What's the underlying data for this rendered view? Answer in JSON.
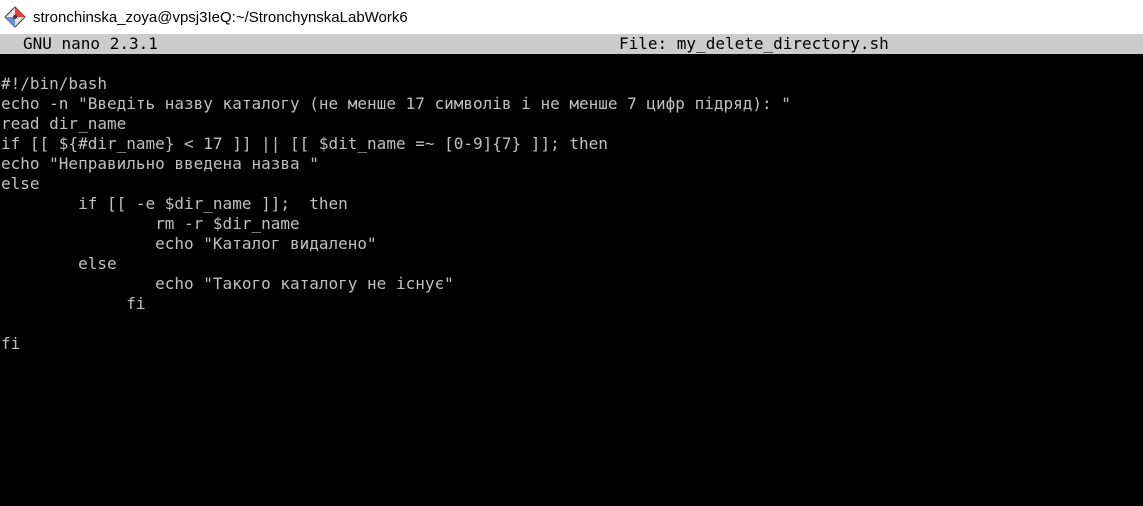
{
  "window": {
    "title": "stronchinska_zoya@vpsj3IeQ:~/StronchynskaLabWork6",
    "icon": "git-bash-diamond-icon",
    "icon_colors": [
      "#f03c2e",
      "#e8e8e8",
      "#6a8fd8",
      "#3a3a3a"
    ]
  },
  "nano": {
    "version_label": "GNU nano 2.3.1",
    "file_label": "File: my_delete_directory.sh"
  },
  "editor": {
    "lines": [
      "#!/bin/bash",
      "echo -n \"Введіть назву каталогу (не менше 17 символів і не менше 7 цифр підряд): \"",
      "read dir_name",
      "if [[ ${#dir_name} < 17 ]] || [[ $dit_name =~ [0-9]{7} ]]; then",
      "echo \"Неправильно введена назва \"",
      "else",
      "        if [[ -e $dir_name ]];  then",
      "                rm -r $dir_name",
      "                echo \"Каталог видалено\"",
      "        else",
      "                echo \"Такого каталогу не існує\"",
      "             fi",
      "",
      "fi"
    ]
  },
  "colors": {
    "terminal_bg": "#000000",
    "terminal_fg": "#c0c0c0",
    "header_bg": "#cccccc",
    "header_fg": "#000000",
    "titlebar_bg": "#ffffff"
  }
}
